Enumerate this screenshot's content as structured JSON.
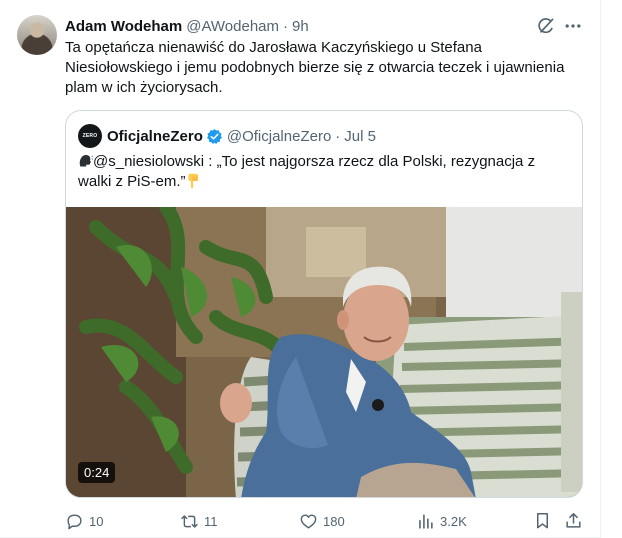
{
  "post": {
    "author_name": "Adam Wodeham",
    "author_handle": "@AWodeham",
    "separator": "·",
    "time": "9h",
    "text": "Ta opętańcza nienawiść do Jarosława Kaczyńskiego u Stefana Niesiołowskiego i jemu podobnych bierze się z otwarcia teczek i ujawnienia plam w ich życiorysach."
  },
  "quote": {
    "avatar_text": "ZERO",
    "author_name": "OficjalneZero",
    "author_handle": "@OficjalneZero",
    "separator": "·",
    "time": "Jul 5",
    "text": "@s_niesiolowski : „To jest najgorsza rzecz dla Polski, rezygnacja z walki z PiS-em.”",
    "video_duration": "0:24"
  },
  "actions": {
    "replies": "10",
    "reposts": "11",
    "likes": "180",
    "views": "3.2K"
  },
  "icons": {
    "grok": "grok-icon",
    "more": "more-icon",
    "verified": "verified-badge-icon",
    "reply": "reply-icon",
    "repost": "repost-icon",
    "like": "heart-icon",
    "views": "views-icon",
    "bookmark": "bookmark-icon",
    "share": "share-icon"
  },
  "colors": {
    "text_primary": "#0f1419",
    "text_secondary": "#536471",
    "verified_blue": "#1d9bf0",
    "border": "#cfd9de"
  }
}
